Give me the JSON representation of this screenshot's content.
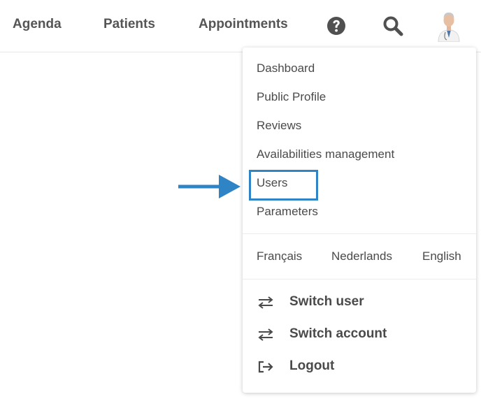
{
  "header": {
    "nav": [
      "Agenda",
      "Patients",
      "Appointments"
    ],
    "icons": [
      "help-icon",
      "search-icon",
      "user-avatar"
    ]
  },
  "dropdown": {
    "menu": [
      "Dashboard",
      "Public Profile",
      "Reviews",
      "Availabilities management",
      "Users",
      "Parameters"
    ],
    "languages": [
      "Français",
      "Nederlands",
      "English"
    ],
    "actions": [
      {
        "label": "Switch user",
        "icon": "switch-arrows-icon"
      },
      {
        "label": "Switch account",
        "icon": "switch-arrows-icon"
      },
      {
        "label": "Logout",
        "icon": "logout-icon"
      }
    ]
  },
  "annotation": {
    "highlighted_item": "Users",
    "color": "#2f84c6"
  },
  "colors": {
    "text": "#4a4a4a",
    "nav_text": "#555555",
    "accent": "#2f84c6"
  }
}
